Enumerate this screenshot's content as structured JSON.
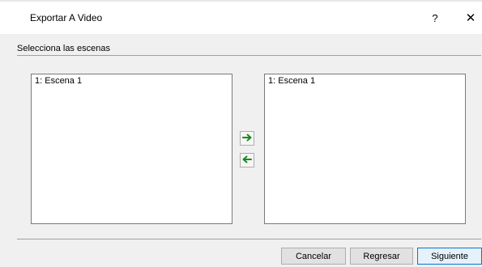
{
  "window": {
    "title": "Exportar A Video",
    "help_label": "?",
    "close_label": "✕"
  },
  "section": {
    "label": "Selecciona las escenas"
  },
  "available_scenes": [
    "1: Escena 1"
  ],
  "selected_scenes": [
    "1: Escena 1"
  ],
  "transfer": {
    "add_icon": "arrow-right-icon",
    "remove_icon": "arrow-left-icon",
    "icon_color": "#1a8a1a"
  },
  "buttons": {
    "cancel": "Cancelar",
    "back": "Regresar",
    "next": "Siguiente"
  },
  "colors": {
    "accent": "#0078d7",
    "client_bg": "#f0f0f0"
  }
}
